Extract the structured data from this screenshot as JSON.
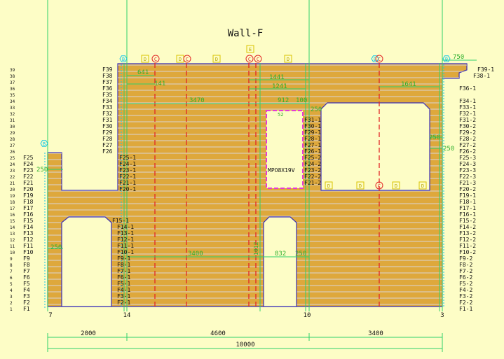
{
  "title": "Wall-F",
  "colors": {
    "background": "#fdfdc6",
    "wall_fill": "#dea83c",
    "course_line": "#d9d3d3",
    "outline": "#3a2fb8",
    "grid_line": "#2ed16a",
    "red_dash": "#e22626",
    "dim_text": "#2fb02f",
    "label_text": "#111111",
    "magenta": "#e63ad6",
    "cyan": "#12c7e8"
  },
  "row_numbers": [
    "1",
    "2",
    "3",
    "4",
    "5",
    "6",
    "7",
    "8",
    "9",
    "10",
    "11",
    "12",
    "13",
    "14",
    "15",
    "16",
    "17",
    "18",
    "19",
    "20",
    "21",
    "22",
    "23",
    "24",
    "25",
    "26",
    "27",
    "28",
    "29",
    "30",
    "31",
    "32",
    "33",
    "34",
    "35",
    "36",
    "37",
    "38",
    "39"
  ],
  "left_labels": [
    "F1",
    "F2",
    "F3",
    "F4",
    "F5",
    "F6",
    "F7",
    "F8",
    "F9",
    "F10",
    "F11",
    "F12",
    "F13",
    "F14",
    "F15",
    "F16",
    "F17",
    "F18",
    "F19",
    "F20",
    "F21",
    "F22",
    "F23",
    "F24",
    "F25"
  ],
  "upper_left_labels": [
    "F26",
    "F27",
    "F28",
    "F29",
    "F30",
    "F31",
    "F32",
    "F33",
    "F34",
    "F35",
    "F36",
    "F37",
    "F38",
    "F39"
  ],
  "pier_labels": [
    "F2-1",
    "F3-1",
    "F4-1",
    "F5-1",
    "F6-1",
    "F7-1",
    "F8-1",
    "F9-1",
    "F10-1",
    "F11-1",
    "F12-1",
    "F13-1",
    "F14-1",
    "F15-1"
  ],
  "pier_upper_labels": [
    "F20-1",
    "F21-1",
    "F22-1",
    "F23-1",
    "F24-1",
    "F25-1"
  ],
  "mid_labels": [
    "F21-2",
    "F22-2",
    "F23-2",
    "F24-2",
    "F25-2",
    "F26-1",
    "F27-1",
    "F28-1",
    "F29-1",
    "F30-1",
    "F31-1"
  ],
  "right_labels": [
    "F1-1",
    "F2-2",
    "F3-2",
    "F4-2",
    "F5-2",
    "F6-2",
    "F7-2",
    "F8-2",
    "F9-2",
    "F10-2",
    "F11-2",
    "F12-2",
    "F13-2",
    "F14-2",
    "F15-2",
    "F16-1",
    "F17-1",
    "F18-1",
    "F19-1",
    "F20-2",
    "F21-3",
    "F22-3",
    "F23-3",
    "F24-3",
    "F25-3",
    "F26-2",
    "F27-2",
    "F28-2",
    "F29-2",
    "F30-2",
    "F31-2",
    "F32-1",
    "F33-1",
    "F34-1"
  ],
  "right_top_labels": [
    "F36-1",
    "F38-1",
    "F39-1"
  ],
  "grid_numbers": [
    "7",
    "14",
    "10",
    "3"
  ],
  "dimensions": {
    "d641": "641",
    "d141": "141",
    "d3470": "3470",
    "d1441": "1441",
    "d1241": "1241",
    "d1641": "1641",
    "d912": "912",
    "d100": "100",
    "d750": "750",
    "d250a": "250",
    "d250b": "250",
    "d250c": "250",
    "d250d": "250",
    "d250e": "250",
    "d250f": "250",
    "d3400mid": "3400",
    "d832": "832",
    "d1012": "1012",
    "d52": "52",
    "bottom_2000": "2000",
    "bottom_4600": "4600",
    "bottom_3400": "3400",
    "bottom_10000": "10000"
  },
  "opening_label": "MPO8X19V",
  "markers": {
    "b": "B",
    "c": "C",
    "d": "D",
    "e": "E"
  }
}
